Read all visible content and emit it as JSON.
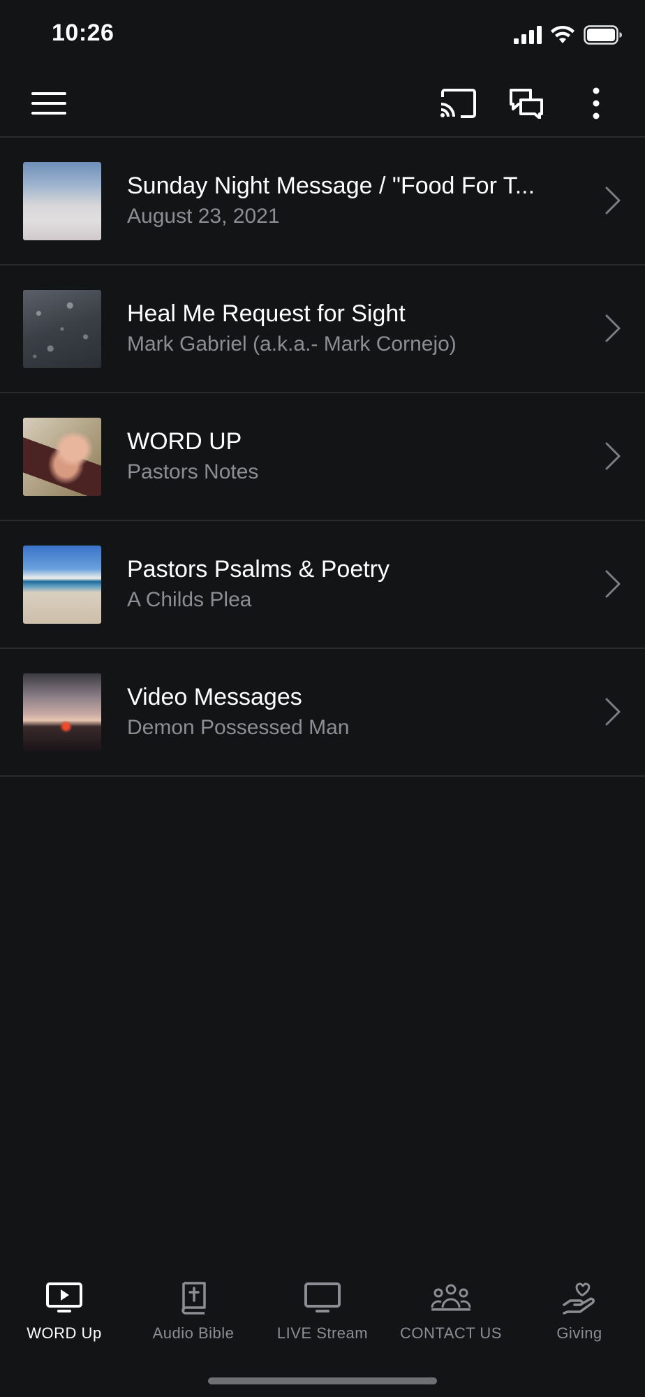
{
  "status_bar": {
    "time": "10:26",
    "icons": [
      "cellular-signal-icon",
      "wifi-icon",
      "battery-icon"
    ]
  },
  "toolbar": {
    "left_icon": "hamburger-menu-icon",
    "right_icons": [
      "cast-icon",
      "chat-icon",
      "more-vertical-icon"
    ]
  },
  "list": {
    "items": [
      {
        "title": "Sunday Night Message / \"Food For T...",
        "subtitle": "August 23, 2021",
        "thumbnail": "sky-clouds"
      },
      {
        "title": "Heal Me Request for Sight",
        "subtitle": "Mark Gabriel (a.k.a.- Mark Cornejo)",
        "thumbnail": "raindrops"
      },
      {
        "title": "WORD UP",
        "subtitle": "Pastors Notes",
        "thumbnail": "hands-on-bible"
      },
      {
        "title": "Pastors Psalms & Poetry",
        "subtitle": "A Childs Plea",
        "thumbnail": "beach"
      },
      {
        "title": "Video Messages",
        "subtitle": "Demon Possessed Man",
        "thumbnail": "sunset"
      }
    ]
  },
  "tabbar": {
    "tabs": [
      {
        "label": "WORD Up",
        "icon": "play-screen-icon",
        "active": true
      },
      {
        "label": "Audio Bible",
        "icon": "bible-icon",
        "active": false
      },
      {
        "label": "LIVE Stream",
        "icon": "monitor-icon",
        "active": false
      },
      {
        "label": "CONTACT US",
        "icon": "people-icon",
        "active": false
      },
      {
        "label": "Giving",
        "icon": "giving-hand-icon",
        "active": false
      }
    ]
  },
  "colors": {
    "background": "#131416",
    "text_primary": "#ffffff",
    "text_secondary": "#8c8e93",
    "divider": "#2a2b2e"
  }
}
